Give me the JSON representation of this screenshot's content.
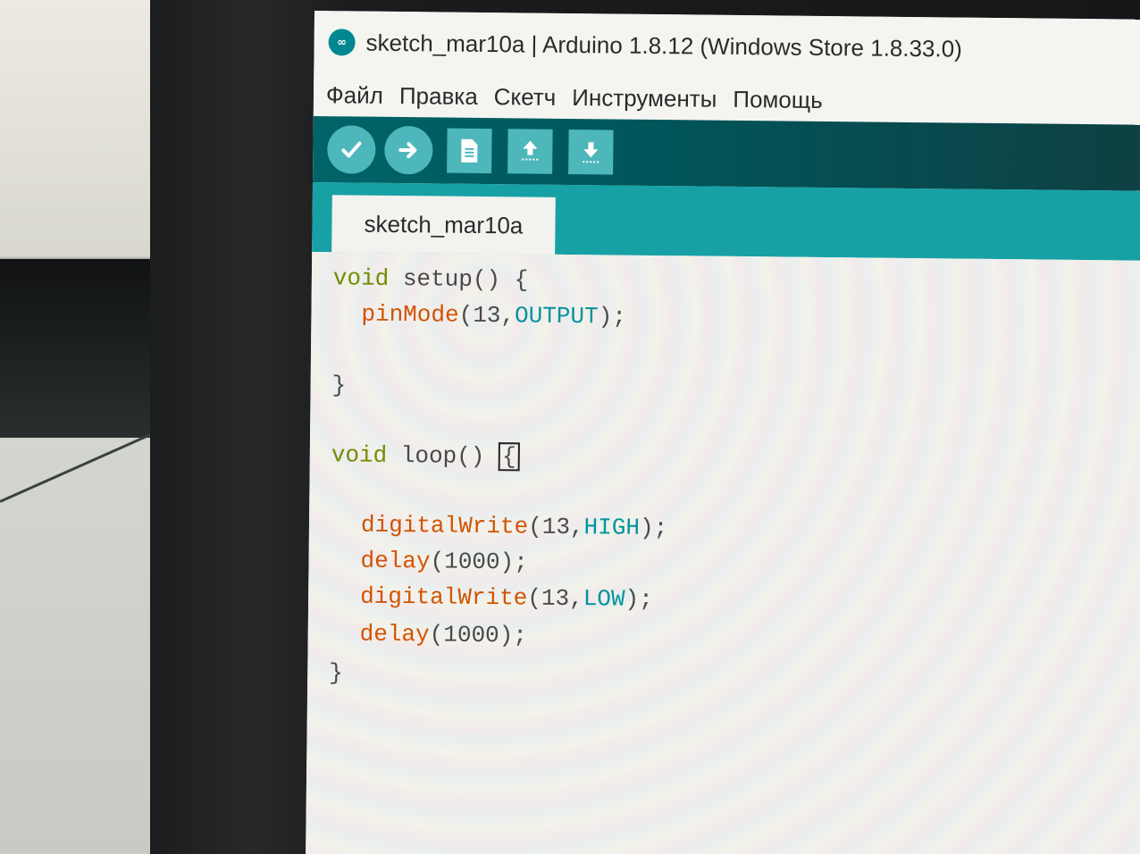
{
  "window": {
    "title": "sketch_mar10a | Arduino 1.8.12 (Windows Store 1.8.33.0)",
    "icon_label": "∞"
  },
  "menu": {
    "items": [
      "Файл",
      "Правка",
      "Скетч",
      "Инструменты",
      "Помощь"
    ]
  },
  "toolbar": {
    "buttons": [
      "verify-icon",
      "upload-icon",
      "new-icon",
      "open-icon",
      "save-icon"
    ]
  },
  "tabs": [
    {
      "label": "sketch_mar10a"
    }
  ],
  "editor": {
    "lines": [
      {
        "kw": "void",
        "rest": " setup() {"
      },
      {
        "fn": "pinMode",
        "args_pre": "(13,",
        "const": "OUTPUT",
        "args_post": ");"
      },
      {
        "text": ""
      },
      {
        "text": "}"
      },
      {
        "text": ""
      },
      {
        "kw": "void",
        "rest": " loop() ",
        "cursor": "{"
      },
      {
        "text": ""
      },
      {
        "fn": "digitalWrite",
        "args_pre": "(13,",
        "const": "HIGH",
        "args_post": ");"
      },
      {
        "fn": "delay",
        "args": "(1000);"
      },
      {
        "fn": "digitalWrite",
        "args_pre": "(13,",
        "const": "LOW",
        "args_post": ");"
      },
      {
        "fn": "delay",
        "args": "(1000);"
      },
      {
        "text": "}"
      }
    ]
  },
  "colors": {
    "teal_dark": "#006468",
    "teal_tab_row": "#17a1a5",
    "button_teal": "#4db7bb",
    "keyword": "#728e00",
    "function": "#d35400",
    "constant": "#00979c"
  }
}
